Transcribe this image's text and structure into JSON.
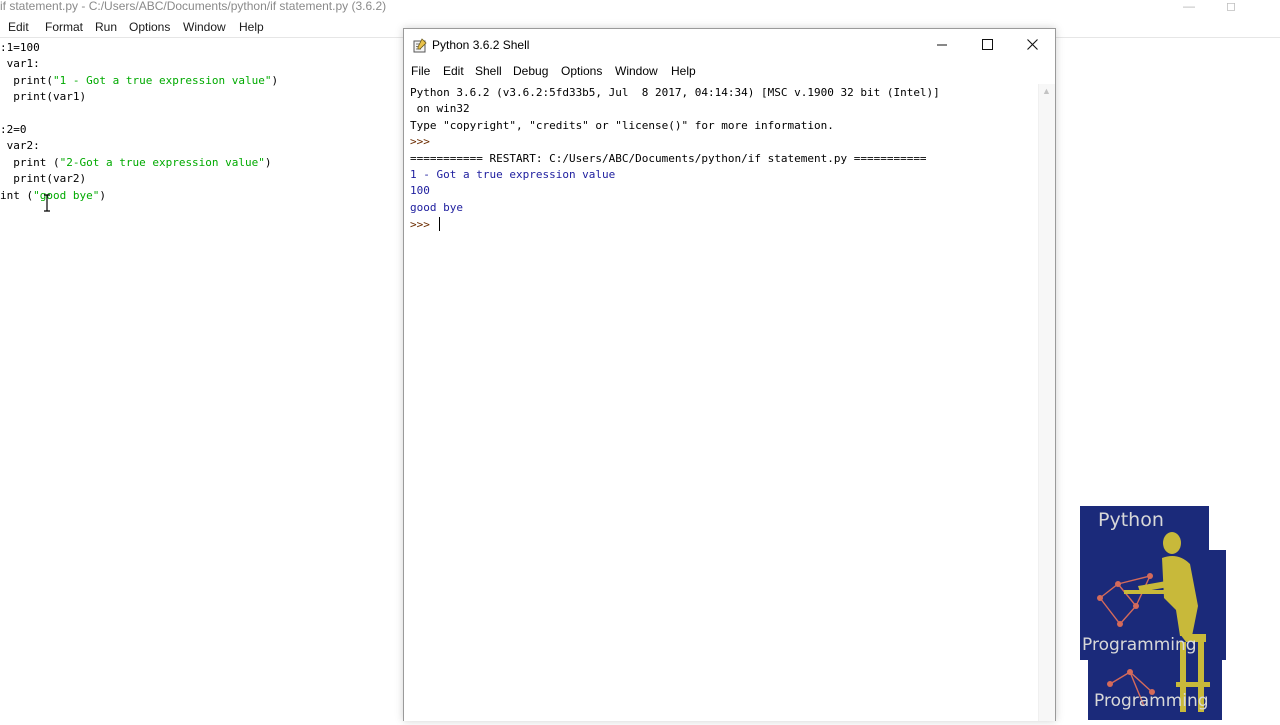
{
  "editor": {
    "title": "if statement.py - C:/Users/ABC/Documents/python/if statement.py (3.6.2)",
    "menu": [
      "Edit",
      "Format",
      "Run",
      "Options",
      "Window",
      "Help"
    ],
    "code": [
      {
        "pre": ":1=100",
        "str": "",
        "post": ""
      },
      {
        "pre": " var1:",
        "str": "",
        "post": ""
      },
      {
        "pre": "  print(",
        "str": "\"1 - Got a true expression value\"",
        "post": ")"
      },
      {
        "pre": "  print(var1)",
        "str": "",
        "post": ""
      },
      {
        "pre": "",
        "str": "",
        "post": ""
      },
      {
        "pre": ":2=0",
        "str": "",
        "post": ""
      },
      {
        "pre": " var2:",
        "str": "",
        "post": ""
      },
      {
        "pre": "  print (",
        "str": "\"2-Got a true expression value\"",
        "post": ")"
      },
      {
        "pre": "  print(var2)",
        "str": "",
        "post": ""
      },
      {
        "pre": "int (",
        "str": "\"good bye\"",
        "post": ")"
      }
    ]
  },
  "shell": {
    "title": "Python 3.6.2 Shell",
    "menu": [
      "File",
      "Edit",
      "Shell",
      "Debug",
      "Options",
      "Window",
      "Help"
    ],
    "lines": [
      {
        "text": "Python 3.6.2 (v3.6.2:5fd33b5, Jul  8 2017, 04:14:34) [MSC v.1900 32 bit (Intel)]",
        "kind": "out-black"
      },
      {
        "text": " on win32",
        "kind": "out-black"
      },
      {
        "text": "Type \"copyright\", \"credits\" or \"license()\" for more information.",
        "kind": "out-black"
      },
      {
        "text": ">>> ",
        "kind": "prompt"
      },
      {
        "text": "=========== RESTART: C:/Users/ABC/Documents/python/if statement.py ===========",
        "kind": "out-black"
      },
      {
        "text": "1 - Got a true expression value",
        "kind": "out-blue"
      },
      {
        "text": "100",
        "kind": "out-blue"
      },
      {
        "text": "good bye",
        "kind": "out-blue"
      },
      {
        "text": ">>> ",
        "kind": "prompt"
      }
    ]
  },
  "logo": {
    "top_word": "Python",
    "bottom_word": "Programming",
    "colors": {
      "bg": "#1b2a7a",
      "figure": "#c8b93a",
      "nodes": "#d46a5a"
    }
  }
}
